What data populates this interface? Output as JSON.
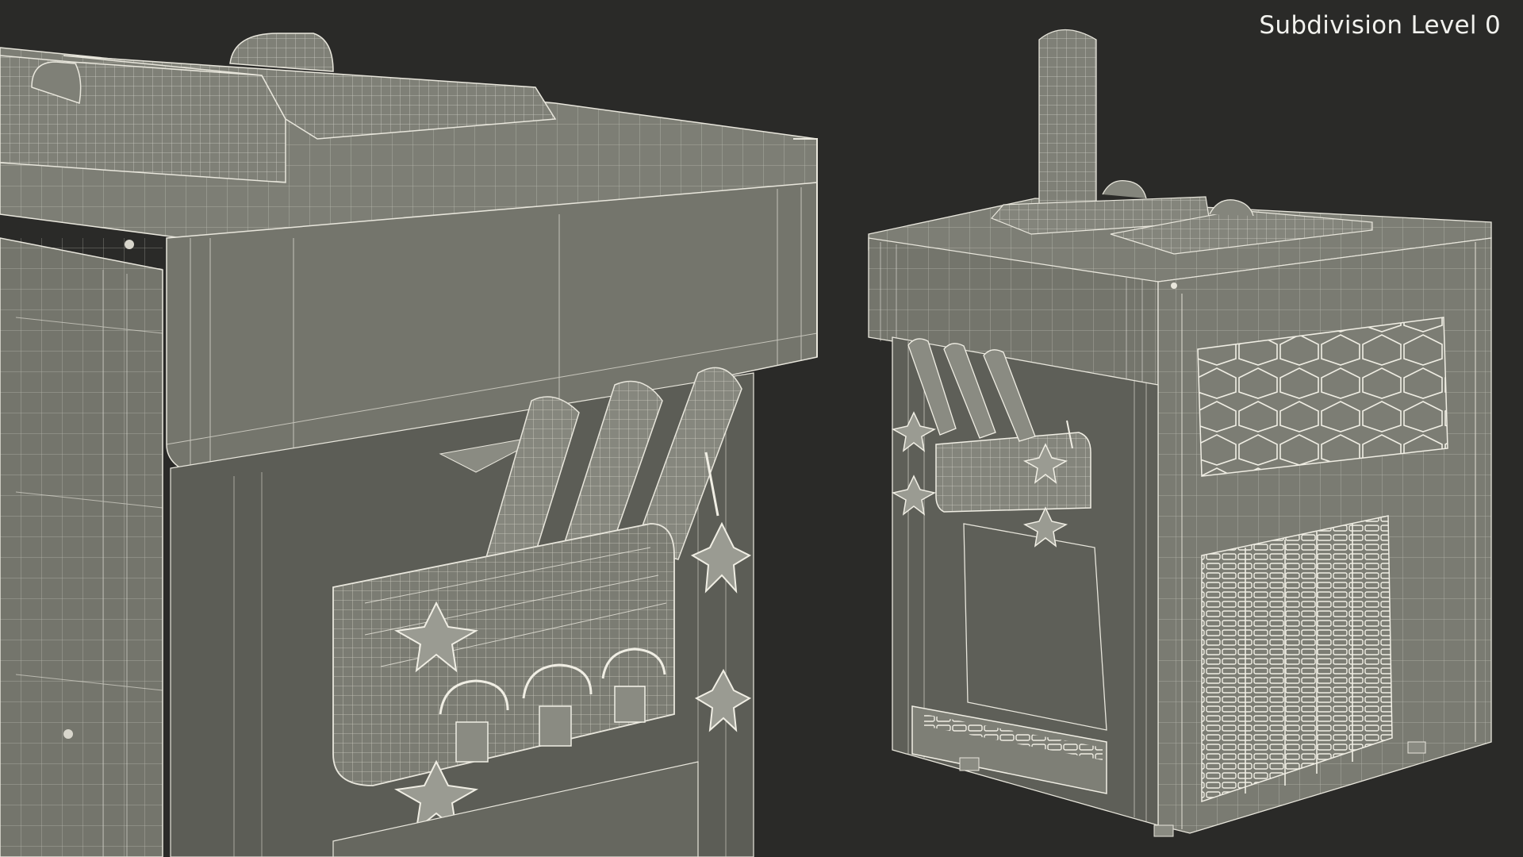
{
  "viewport": {
    "overlay_label": "Subdivision Level 0",
    "background": "#2a2a28",
    "model_color": "#7a7b72",
    "wire_color": "#e8e6dc",
    "subjects": [
      "ice-cream-machine-closeup",
      "ice-cream-machine-full"
    ]
  }
}
